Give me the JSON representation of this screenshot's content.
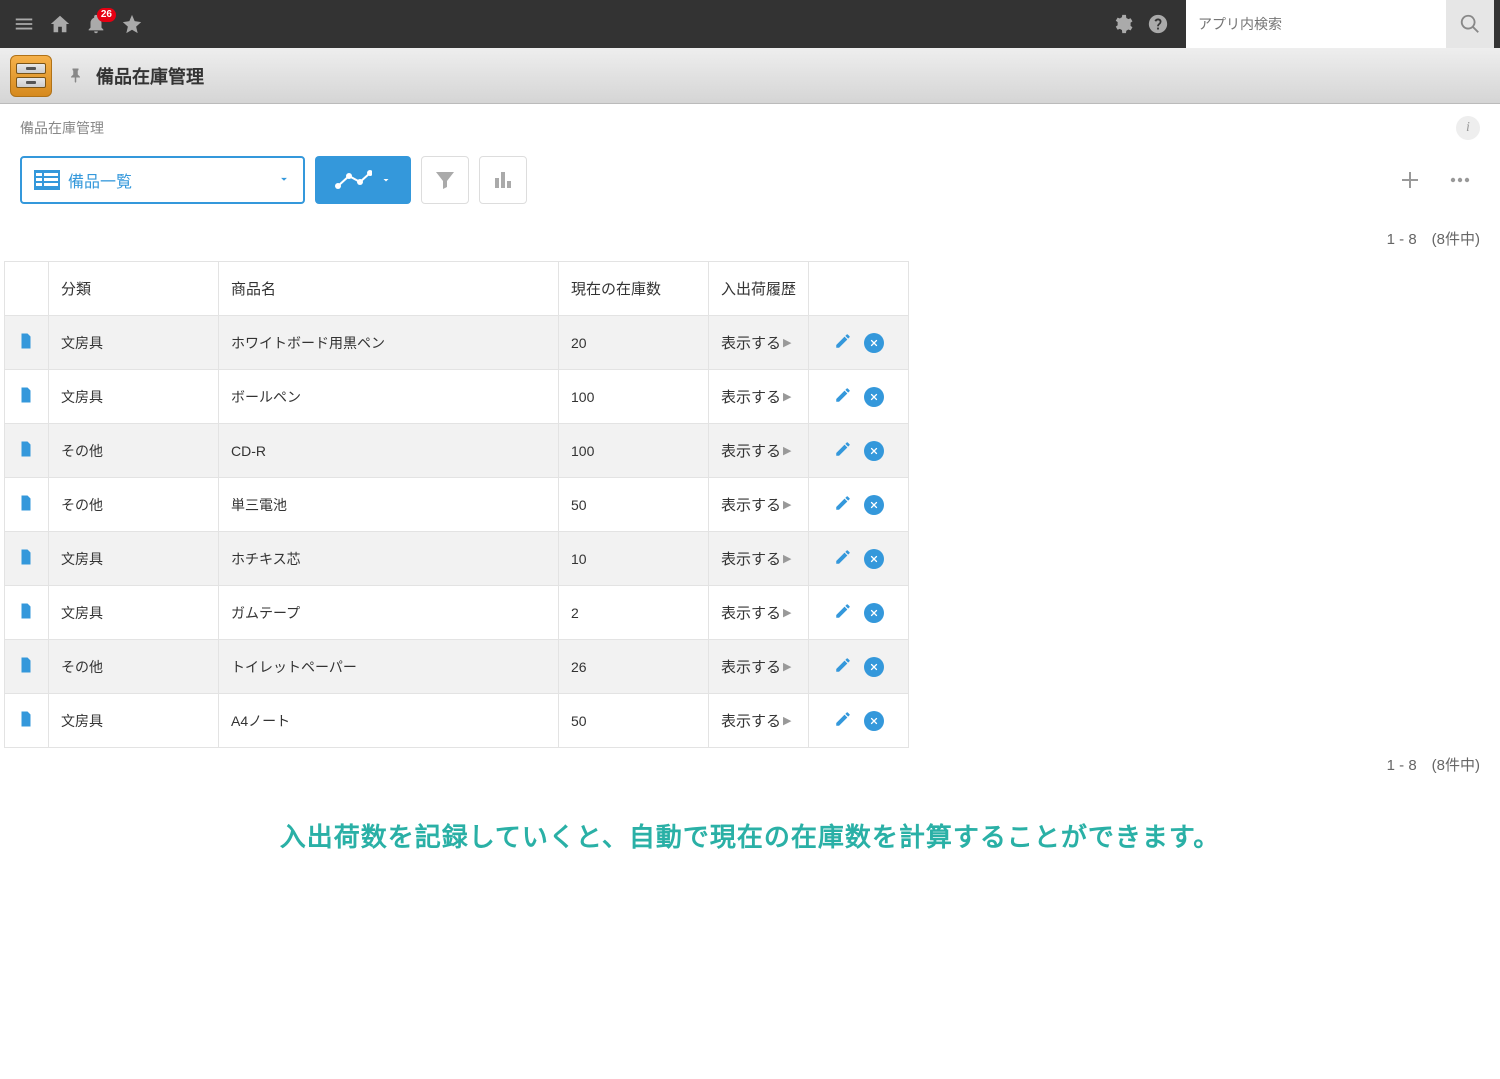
{
  "header": {
    "notification_count": "26",
    "search_placeholder": "アプリ内検索"
  },
  "app": {
    "title": "備品在庫管理"
  },
  "breadcrumb": "備品在庫管理",
  "view_selector": {
    "label": "備品一覧"
  },
  "pagination": "1 - 8　(8件中)",
  "table": {
    "headers": {
      "category": "分類",
      "name": "商品名",
      "stock": "現在の在庫数",
      "history": "入出荷履歴"
    },
    "history_link": "表示する",
    "rows": [
      {
        "category": "文房具",
        "name": "ホワイトボード用黒ペン",
        "stock": "20"
      },
      {
        "category": "文房具",
        "name": "ボールペン",
        "stock": "100"
      },
      {
        "category": "その他",
        "name": "CD-R",
        "stock": "100"
      },
      {
        "category": "その他",
        "name": "単三電池",
        "stock": "50"
      },
      {
        "category": "文房具",
        "name": "ホチキス芯",
        "stock": "10"
      },
      {
        "category": "文房具",
        "name": "ガムテープ",
        "stock": "2"
      },
      {
        "category": "その他",
        "name": "トイレットペーパー",
        "stock": "26"
      },
      {
        "category": "文房具",
        "name": "A4ノート",
        "stock": "50"
      }
    ]
  },
  "footer_message": "入出荷数を記録していくと、自動で現在の在庫数を計算することができます。"
}
